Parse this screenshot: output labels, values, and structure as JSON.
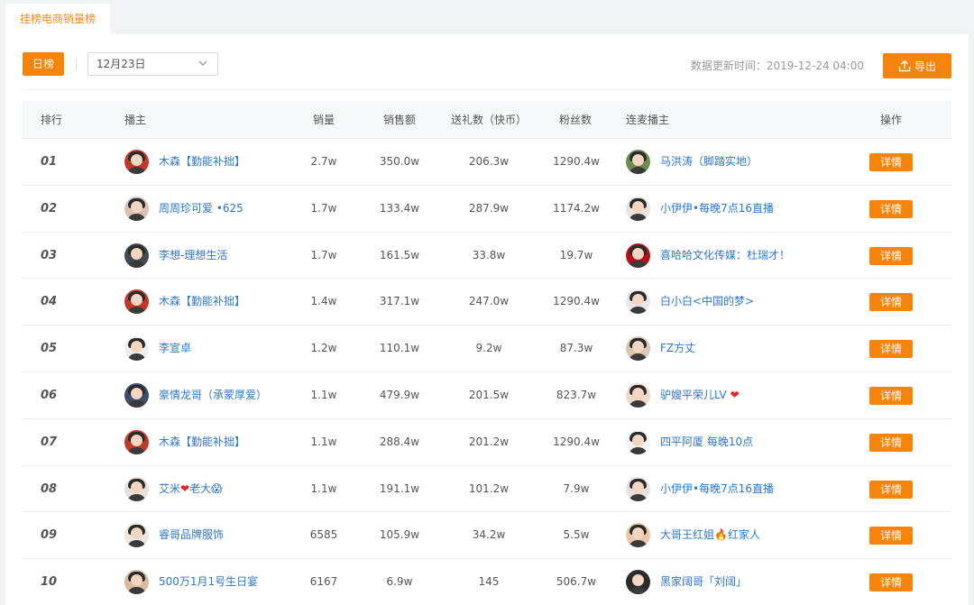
{
  "tab": {
    "label": "挂榜电商销量榜"
  },
  "toolbar": {
    "day_button": "日榜",
    "date_value": "12月23日",
    "update_label": "数据更新时间：",
    "update_time": "2019-12-24 04:00",
    "export_label": "导出"
  },
  "table": {
    "headers": {
      "rank": "排行",
      "anchor": "播主",
      "sales": "销量",
      "revenue": "销售额",
      "gifts": "送礼数（快币）",
      "fans": "粉丝数",
      "linked": "连麦播主",
      "action": "操作"
    },
    "detail_label": "详情",
    "rows": [
      {
        "rank": "01",
        "anchor": "木森【勤能补拙】",
        "sales": "2.7w",
        "revenue": "350.0w",
        "gifts": "206.3w",
        "fans": "1290.4w",
        "linked": "马洪涛（脚踏实地）",
        "a1": "#c0392b",
        "a2": "#6b8e4e"
      },
      {
        "rank": "02",
        "anchor": "周周珍可爱 •625",
        "sales": "1.7w",
        "revenue": "133.4w",
        "gifts": "287.9w",
        "fans": "1174.2w",
        "linked": "小伊伊•每晚7点16直播",
        "a1": "#d8c2b4",
        "a2": "#e9e2e0"
      },
      {
        "rank": "03",
        "anchor": "李想-理想生活",
        "sales": "1.7w",
        "revenue": "161.5w",
        "gifts": "33.8w",
        "fans": "19.7w",
        "linked": "喜哈哈文化传媒：杜瑞才！",
        "a1": "#444a52",
        "a2": "#b3121b"
      },
      {
        "rank": "04",
        "anchor": "木森【勤能补拙】",
        "sales": "1.4w",
        "revenue": "317.1w",
        "gifts": "247.0w",
        "fans": "1290.4w",
        "linked": "白小白<中国的梦>",
        "a1": "#c0392b",
        "a2": "#e8e8e8"
      },
      {
        "rank": "05",
        "anchor": "李宣卓",
        "sales": "1.2w",
        "revenue": "110.1w",
        "gifts": "9.2w",
        "fans": "87.3w",
        "linked": "FZ方丈",
        "a1": "#eeeeee",
        "a2": "#d9c7b5"
      },
      {
        "rank": "06",
        "anchor": "豪情龙哥（承蒙厚爱）",
        "sales": "1.1w",
        "revenue": "479.9w",
        "gifts": "201.5w",
        "fans": "823.7w",
        "linked": "驴嫂平荣儿LV",
        "linked_heart": "❤",
        "a1": "#3d4e6b",
        "a2": "#f0d9c8"
      },
      {
        "rank": "07",
        "anchor": "木森【勤能补拙】",
        "sales": "1.1w",
        "revenue": "288.4w",
        "gifts": "201.2w",
        "fans": "1290.4w",
        "linked": "四平阿厦 每晚10点",
        "a1": "#c0392b",
        "a2": "#f4f4f4"
      },
      {
        "rank": "08",
        "anchor": "艾米",
        "anchor_heart": "❤",
        "anchor_tail": "老大",
        "anchor_emoji": "😱",
        "sales": "1.1w",
        "revenue": "191.1w",
        "gifts": "101.2w",
        "fans": "7.9w",
        "linked": "小伊伊•每晚7点16直播",
        "a1": "#e6e0d8",
        "a2": "#e9e2e0"
      },
      {
        "rank": "09",
        "anchor": "睿哥品牌服饰",
        "sales": "6585",
        "revenue": "105.9w",
        "gifts": "34.2w",
        "fans": "5.5w",
        "linked": "大哥王红姐",
        "linked_emoji": "🔥",
        "linked_tail": "红家人",
        "a1": "#ece6e2",
        "a2": "#e9c9a8"
      },
      {
        "rank": "10",
        "anchor": "500万1月1号生日宴",
        "sales": "6167",
        "revenue": "6.9w",
        "gifts": "145",
        "fans": "506.7w",
        "linked": "黑家阔哥「刘阔」",
        "a1": "#d9b9a0",
        "a2": "#2b2b2b"
      }
    ]
  }
}
